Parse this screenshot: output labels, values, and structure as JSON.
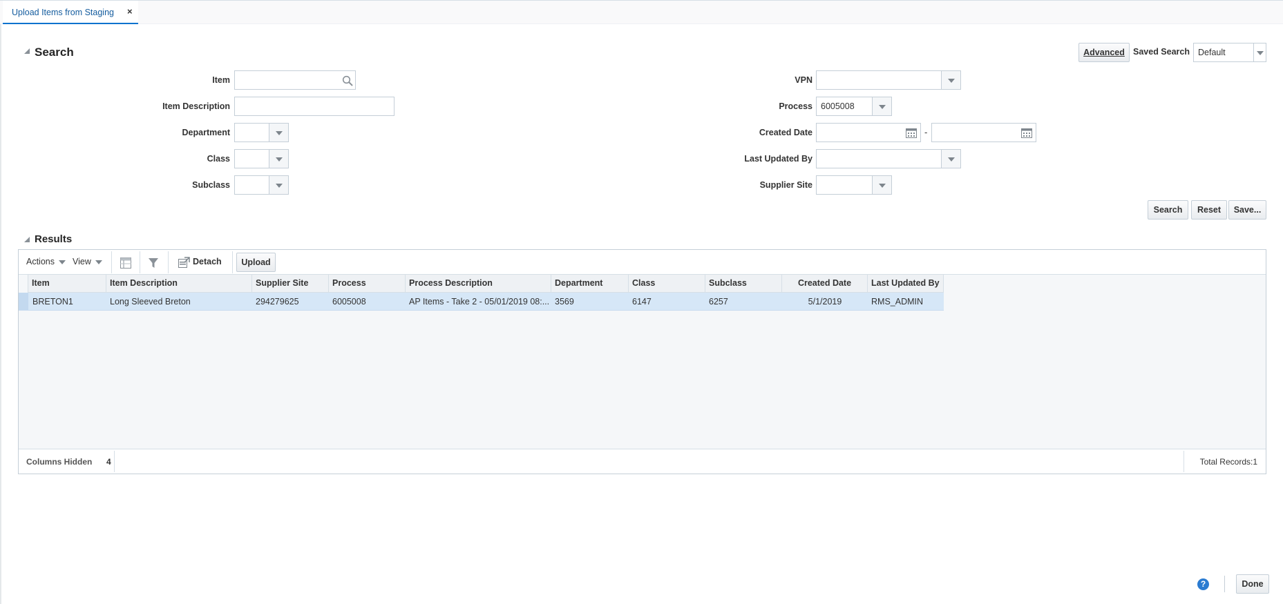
{
  "tab": {
    "label": "Upload Items from Staging",
    "close": "×"
  },
  "search": {
    "title": "Search",
    "advanced_label": "Advanced",
    "saved_search_label": "Saved Search",
    "saved_search_value": "Default",
    "fields": {
      "item": {
        "label": "Item",
        "value": ""
      },
      "item_description": {
        "label": "Item Description",
        "value": ""
      },
      "department": {
        "label": "Department",
        "value": ""
      },
      "class": {
        "label": "Class",
        "value": ""
      },
      "subclass": {
        "label": "Subclass",
        "value": ""
      },
      "vpn": {
        "label": "VPN",
        "value": ""
      },
      "process": {
        "label": "Process",
        "value": "6005008"
      },
      "created_date": {
        "label": "Created Date",
        "separator": "-",
        "from": "",
        "to": ""
      },
      "last_updated_by": {
        "label": "Last Updated By",
        "value": ""
      },
      "supplier_site": {
        "label": "Supplier Site",
        "value": ""
      }
    },
    "buttons": {
      "search": "Search",
      "reset": "Reset",
      "save": "Save..."
    }
  },
  "results": {
    "title": "Results",
    "toolbar": {
      "actions": "Actions",
      "view": "View",
      "detach": "Detach",
      "upload": "Upload"
    },
    "columns": [
      "Item",
      "Item Description",
      "Supplier Site",
      "Process",
      "Process Description",
      "Department",
      "Class",
      "Subclass",
      "Created Date",
      "Last Updated By"
    ],
    "rows": [
      {
        "item": "BRETON1",
        "item_description": "Long Sleeved Breton",
        "supplier_site": "294279625",
        "process": "6005008",
        "process_description": "AP Items - Take 2 - 05/01/2019 08:...",
        "department": "3569",
        "class": "6147",
        "subclass": "6257",
        "created_date": "5/1/2019",
        "last_updated_by": "RMS_ADMIN"
      }
    ],
    "footer": {
      "columns_hidden_label": "Columns Hidden",
      "columns_hidden_count": "4",
      "total_records": "Total Records:1"
    }
  },
  "bottom": {
    "done": "Done",
    "help_icon": "?"
  },
  "colors": {
    "accent": "#0572ce",
    "selected_row": "#d6e7f7",
    "tab_text": "#145c9e"
  }
}
